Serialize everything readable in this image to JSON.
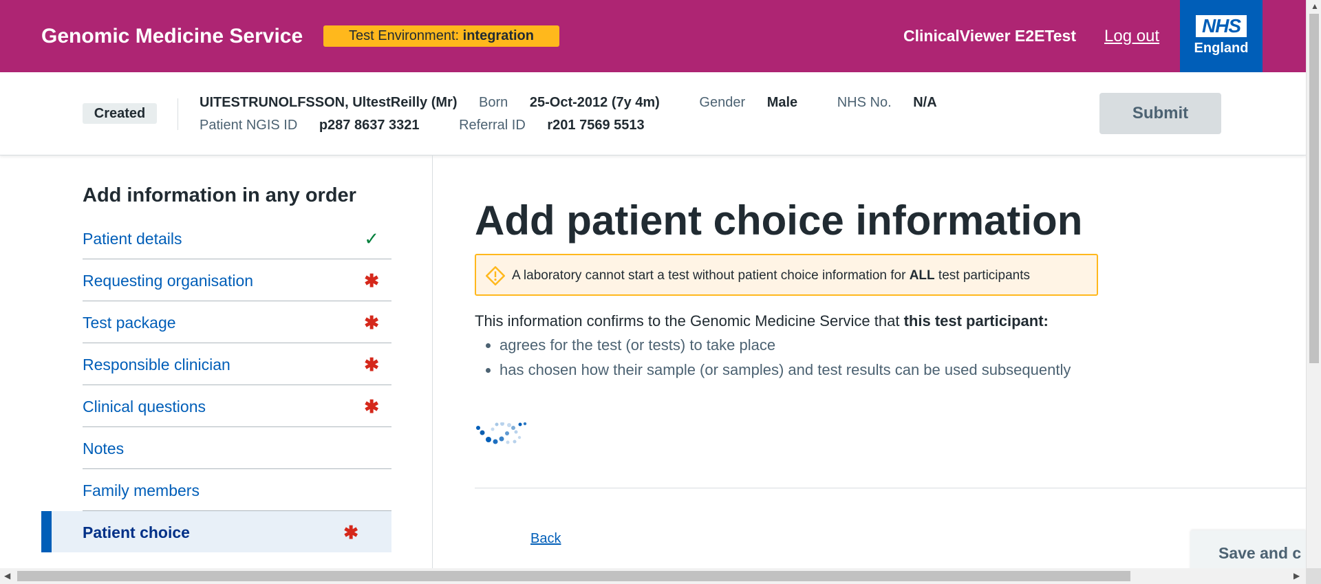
{
  "header": {
    "service_name": "Genomic Medicine Service",
    "env_label": "Test Environment:",
    "env_value": "integration",
    "user": "ClinicalViewer E2ETest",
    "logout": "Log out",
    "logo_nhs": "NHS",
    "logo_region": "England"
  },
  "banner": {
    "status": "Created",
    "patient_name": "UITESTRUNOLFSSON, UltestReilly (Mr)",
    "born_label": "Born",
    "born_value": "25-Oct-2012 (7y 4m)",
    "gender_label": "Gender",
    "gender_value": "Male",
    "nhs_label": "NHS No.",
    "nhs_value": "N/A",
    "ngis_label": "Patient NGIS ID",
    "ngis_value": "p287 8637 3321",
    "referral_label": "Referral ID",
    "referral_value": "r201 7569 5513",
    "submit": "Submit"
  },
  "sidebar": {
    "heading": "Add information in any order",
    "items": [
      {
        "label": "Patient details",
        "status": "✓"
      },
      {
        "label": "Requesting organisation",
        "status": "✱"
      },
      {
        "label": "Test package",
        "status": "✱"
      },
      {
        "label": "Responsible clinician",
        "status": "✱"
      },
      {
        "label": "Clinical questions",
        "status": "✱"
      },
      {
        "label": "Notes",
        "status": ""
      },
      {
        "label": "Family members",
        "status": ""
      },
      {
        "label": "Patient choice",
        "status": "✱"
      }
    ]
  },
  "main": {
    "title": "Add patient choice information",
    "warning_pre": "A laboratory cannot start a test without patient choice information for ",
    "warning_bold": "ALL",
    "warning_post": " test participants",
    "intro_pre": "This information confirms to the Genomic Medicine Service that ",
    "intro_bold": "this test participant:",
    "bullets": [
      "agrees for the test (or tests) to take place",
      "has chosen how their sample (or samples) and test results can be used subsequently"
    ],
    "back": "Back",
    "save_continue": "Save and c"
  },
  "colors": {
    "header_bg": "#ae2573",
    "nhs_blue": "#005eb8",
    "env_badge": "#ffb81c",
    "required_star": "#d5281b",
    "complete_tick": "#007f3b"
  }
}
